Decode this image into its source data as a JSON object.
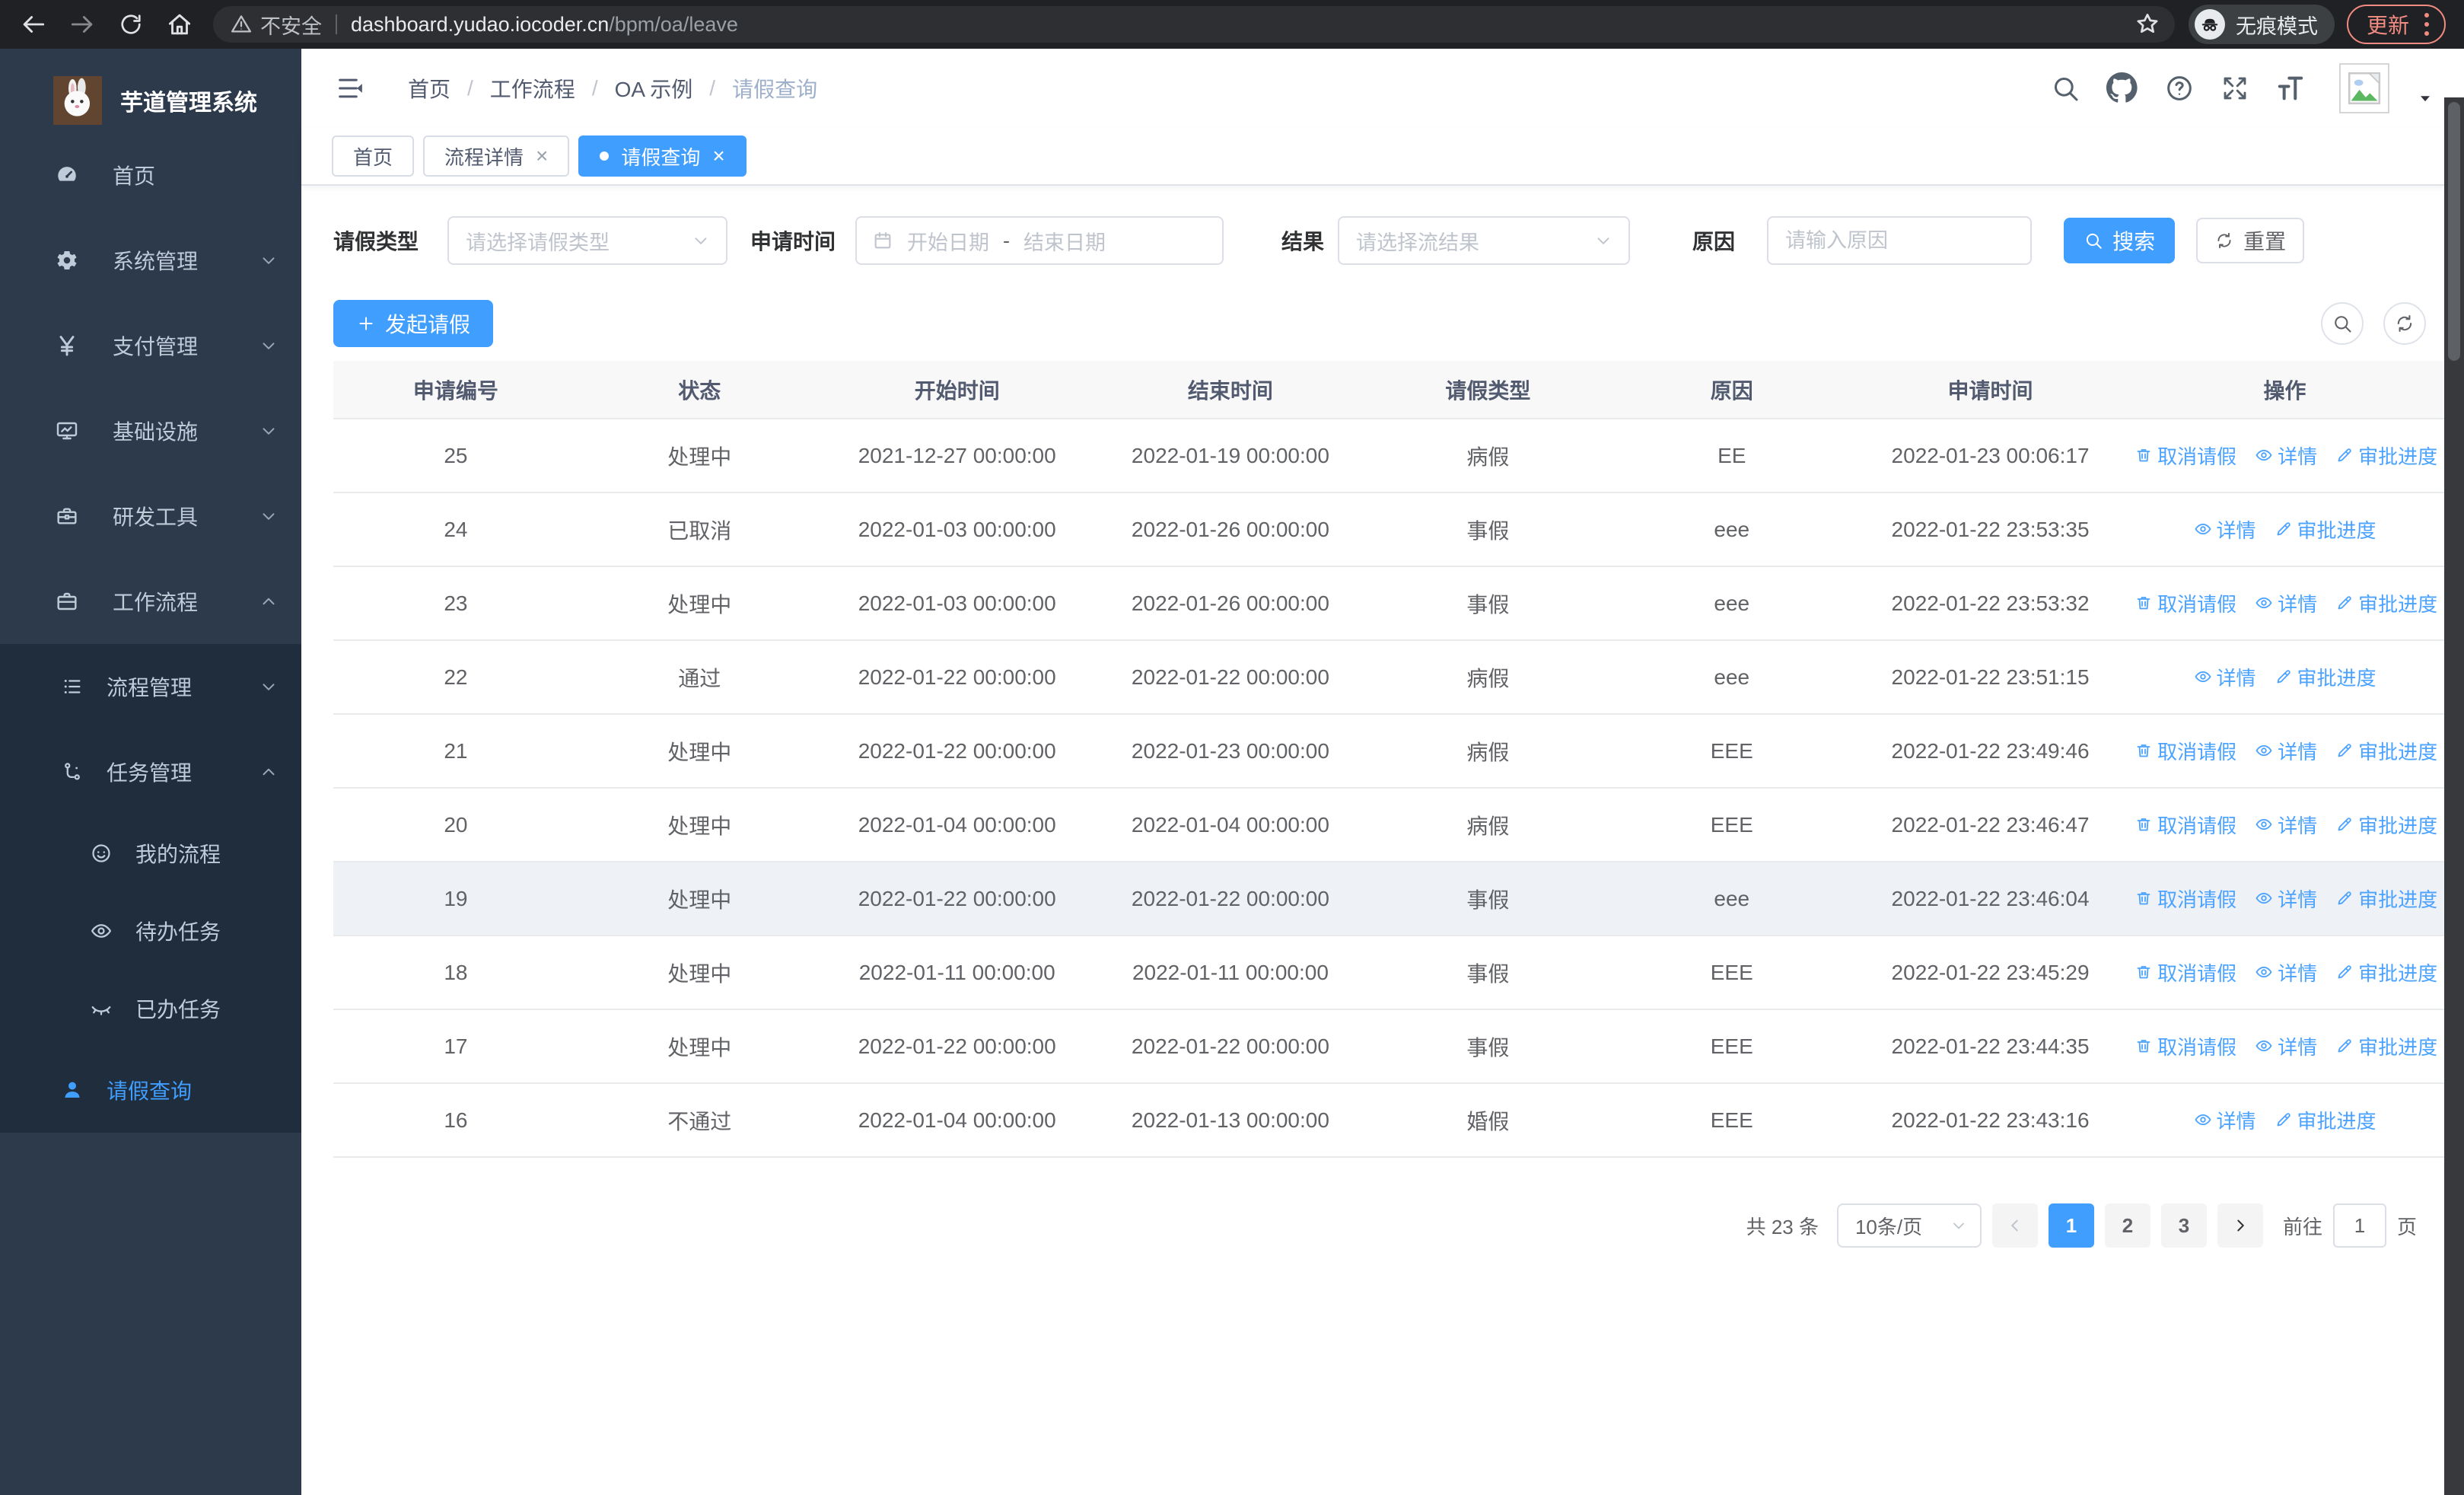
{
  "theme": {
    "primary": "#409eff",
    "sidebar_bg": "#2d3a4b",
    "submenu_bg": "#1f2d3d",
    "update_accent": "#f28b82",
    "link_blue": "#4ba3ff"
  },
  "browser": {
    "security_label": "不安全",
    "url_host": "dashboard.yudao.iocoder.cn",
    "url_path": "/bpm/oa/leave",
    "incognito_label": "无痕模式",
    "update_label": "更新"
  },
  "sidebar": {
    "title": "芋道管理系统",
    "items": [
      {
        "id": "home",
        "label": "首页",
        "icon": "dashboard",
        "level": "root",
        "dark": false,
        "arrow": "",
        "active": false
      },
      {
        "id": "system",
        "label": "系统管理",
        "icon": "gear",
        "level": "root",
        "dark": false,
        "arrow": "down",
        "active": false
      },
      {
        "id": "payment",
        "label": "支付管理",
        "icon": "yen",
        "level": "root",
        "dark": false,
        "arrow": "down",
        "active": false
      },
      {
        "id": "infra",
        "label": "基础设施",
        "icon": "monitor",
        "level": "root",
        "dark": false,
        "arrow": "down",
        "active": false
      },
      {
        "id": "devtools",
        "label": "研发工具",
        "icon": "toolbox",
        "level": "root",
        "dark": false,
        "arrow": "down",
        "active": false
      },
      {
        "id": "workflow",
        "label": "工作流程",
        "icon": "suitcase",
        "level": "root",
        "dark": false,
        "arrow": "up",
        "active": false
      },
      {
        "id": "process-mgr",
        "label": "流程管理",
        "icon": "list",
        "level": "sub",
        "dark": true,
        "arrow": "down",
        "active": false
      },
      {
        "id": "task-mgr",
        "label": "任务管理",
        "icon": "flow",
        "level": "sub",
        "dark": true,
        "arrow": "up",
        "active": false
      },
      {
        "id": "my-process",
        "label": "我的流程",
        "icon": "face",
        "level": "subsub",
        "dark": true,
        "arrow": "",
        "active": false
      },
      {
        "id": "todo-task",
        "label": "待办任务",
        "icon": "eye-open",
        "level": "subsub",
        "dark": true,
        "arrow": "",
        "active": false
      },
      {
        "id": "done-task",
        "label": "已办任务",
        "icon": "eye-closed",
        "level": "subsub",
        "dark": true,
        "arrow": "",
        "active": false
      },
      {
        "id": "leave-query",
        "label": "请假查询",
        "icon": "user",
        "level": "sub",
        "dark": true,
        "arrow": "",
        "active": true
      }
    ]
  },
  "header": {
    "breadcrumbs": [
      "首页",
      "工作流程",
      "OA 示例",
      "请假查询"
    ]
  },
  "tabs": [
    {
      "label": "首页",
      "closable": false,
      "active": false
    },
    {
      "label": "流程详情",
      "closable": true,
      "active": false
    },
    {
      "label": "请假查询",
      "closable": true,
      "active": true
    }
  ],
  "filters": {
    "type_label": "请假类型",
    "type_placeholder": "请选择请假类型",
    "time_label": "申请时间",
    "start_placeholder": "开始日期",
    "range_separator": "-",
    "end_placeholder": "结束日期",
    "result_label": "结果",
    "result_placeholder": "请选择流结果",
    "reason_label": "原因",
    "reason_placeholder": "请输入原因",
    "search_label": "搜索",
    "reset_label": "重置"
  },
  "toolbar": {
    "create_label": "发起请假"
  },
  "table": {
    "headers": [
      "申请编号",
      "状态",
      "开始时间",
      "结束时间",
      "请假类型",
      "原因",
      "申请时间",
      "操作"
    ],
    "actions": {
      "cancel": "取消请假",
      "detail": "详情",
      "progress": "审批进度"
    },
    "rows": [
      {
        "id": "25",
        "status": "处理中",
        "start": "2021-12-27 00:00:00",
        "end": "2022-01-19 00:00:00",
        "type": "病假",
        "reason": "EE",
        "applied": "2022-01-23 00:06:17",
        "cancelable": true,
        "highlighted": false
      },
      {
        "id": "24",
        "status": "已取消",
        "start": "2022-01-03 00:00:00",
        "end": "2022-01-26 00:00:00",
        "type": "事假",
        "reason": "eee",
        "applied": "2022-01-22 23:53:35",
        "cancelable": false,
        "highlighted": false
      },
      {
        "id": "23",
        "status": "处理中",
        "start": "2022-01-03 00:00:00",
        "end": "2022-01-26 00:00:00",
        "type": "事假",
        "reason": "eee",
        "applied": "2022-01-22 23:53:32",
        "cancelable": true,
        "highlighted": false
      },
      {
        "id": "22",
        "status": "通过",
        "start": "2022-01-22 00:00:00",
        "end": "2022-01-22 00:00:00",
        "type": "病假",
        "reason": "eee",
        "applied": "2022-01-22 23:51:15",
        "cancelable": false,
        "highlighted": false
      },
      {
        "id": "21",
        "status": "处理中",
        "start": "2022-01-22 00:00:00",
        "end": "2022-01-23 00:00:00",
        "type": "病假",
        "reason": "EEE",
        "applied": "2022-01-22 23:49:46",
        "cancelable": true,
        "highlighted": false
      },
      {
        "id": "20",
        "status": "处理中",
        "start": "2022-01-04 00:00:00",
        "end": "2022-01-04 00:00:00",
        "type": "病假",
        "reason": "EEE",
        "applied": "2022-01-22 23:46:47",
        "cancelable": true,
        "highlighted": false
      },
      {
        "id": "19",
        "status": "处理中",
        "start": "2022-01-22 00:00:00",
        "end": "2022-01-22 00:00:00",
        "type": "事假",
        "reason": "eee",
        "applied": "2022-01-22 23:46:04",
        "cancelable": true,
        "highlighted": true
      },
      {
        "id": "18",
        "status": "处理中",
        "start": "2022-01-11 00:00:00",
        "end": "2022-01-11 00:00:00",
        "type": "事假",
        "reason": "EEE",
        "applied": "2022-01-22 23:45:29",
        "cancelable": true,
        "highlighted": false
      },
      {
        "id": "17",
        "status": "处理中",
        "start": "2022-01-22 00:00:00",
        "end": "2022-01-22 00:00:00",
        "type": "事假",
        "reason": "EEE",
        "applied": "2022-01-22 23:44:35",
        "cancelable": true,
        "highlighted": false
      },
      {
        "id": "16",
        "status": "不通过",
        "start": "2022-01-04 00:00:00",
        "end": "2022-01-13 00:00:00",
        "type": "婚假",
        "reason": "EEE",
        "applied": "2022-01-22 23:43:16",
        "cancelable": false,
        "highlighted": false
      }
    ]
  },
  "pagination": {
    "total_label": "共 23 条",
    "page_size_label": "10条/页",
    "pages": [
      "1",
      "2",
      "3"
    ],
    "active_page": "1",
    "goto_label": "前往",
    "goto_value": "1",
    "unit_label": "页"
  }
}
